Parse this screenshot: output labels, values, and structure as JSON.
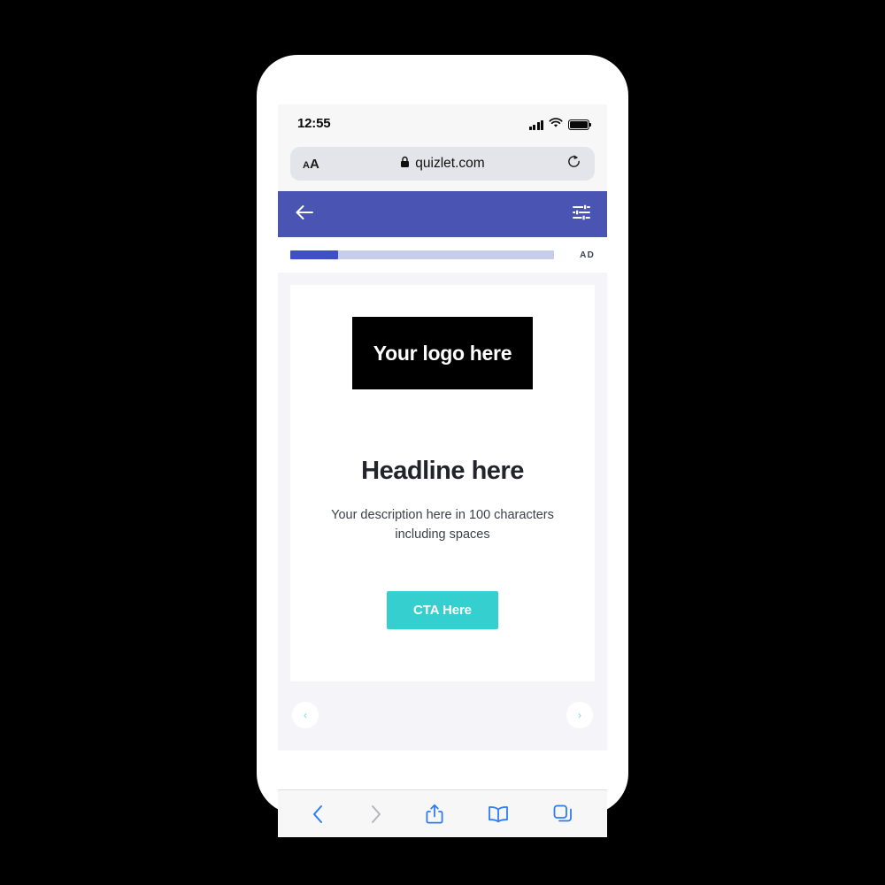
{
  "device": {
    "status_bar": {
      "time": "12:55",
      "icons": [
        "cellular-signal-icon",
        "wifi-icon",
        "battery-icon"
      ]
    },
    "browser": {
      "name": "Safari",
      "url_bar": {
        "text_size_small": "A",
        "text_size_large": "A",
        "lock_icon": "lock-icon",
        "url": "quizlet.com",
        "reload_icon": "reload-icon"
      },
      "toolbar": [
        {
          "name": "back-button",
          "icon": "chevron-left-icon",
          "state": "enabled"
        },
        {
          "name": "forward-button",
          "icon": "chevron-right-icon",
          "state": "disabled"
        },
        {
          "name": "share-button",
          "icon": "share-icon",
          "state": "enabled"
        },
        {
          "name": "bookmarks-button",
          "icon": "book-icon",
          "state": "enabled"
        },
        {
          "name": "tabs-button",
          "icon": "tabs-icon",
          "state": "enabled"
        }
      ]
    }
  },
  "app_bar": {
    "back_icon": "arrow-left-icon",
    "settings_icon": "sliders-icon",
    "background_color": "#4a55b3"
  },
  "progress": {
    "percent": 18,
    "fill_color": "#3f4fc4",
    "track_color": "#c5cdea",
    "ad_label": "AD"
  },
  "ad": {
    "logo_text": "Your logo here",
    "logo_background": "#000000",
    "headline": "Headline here",
    "description": "Your description here in 100 characters including spaces",
    "cta_label": "CTA Here",
    "cta_color": "#36cfcf",
    "carousel": {
      "prev_icon": "chevron-left-icon",
      "prev_label": "‹",
      "next_icon": "chevron-right-icon",
      "next_label": "›"
    }
  }
}
